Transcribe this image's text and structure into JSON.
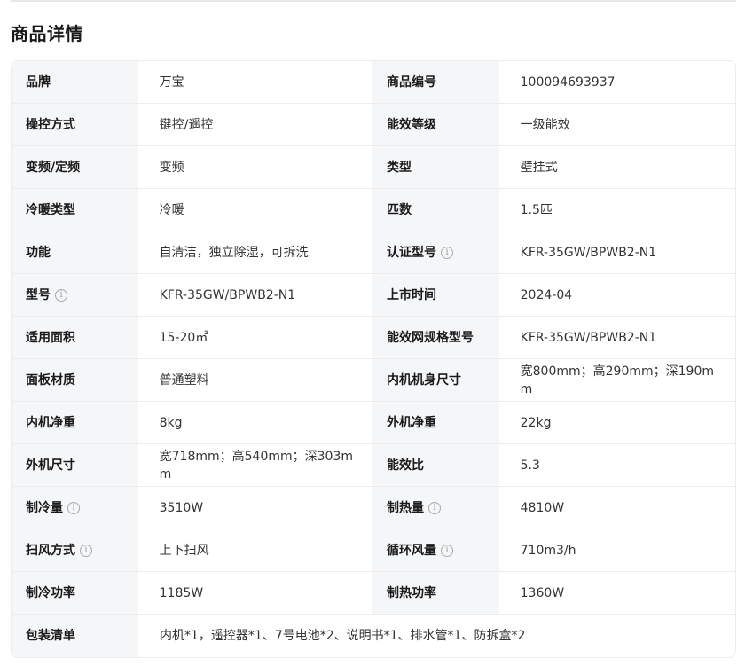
{
  "section_title": "商品详情",
  "rows": [
    {
      "l1": "品牌",
      "v1": "万宝",
      "l2": "商品编号",
      "v2": "100094693937"
    },
    {
      "l1": "操控方式",
      "v1": "键控/遥控",
      "l2": "能效等级",
      "v2": "一级能效"
    },
    {
      "l1": "变频/定频",
      "v1": "变频",
      "l2": "类型",
      "v2": "壁挂式"
    },
    {
      "l1": "冷暖类型",
      "v1": "冷暖",
      "l2": "匹数",
      "v2": "1.5匹"
    },
    {
      "l1": "功能",
      "v1": "自清洁，独立除湿，可拆洗",
      "l2": "认证型号",
      "v2": "KFR-35GW/BPWB2-N1"
    },
    {
      "l1": "型号",
      "v1": "KFR-35GW/BPWB2-N1",
      "l2": "上市时间",
      "v2": "2024-04"
    },
    {
      "l1": "适用面积",
      "v1": "15-20㎡",
      "l2": "能效网规格型号",
      "v2": "KFR-35GW/BPWB2-N1"
    },
    {
      "l1": "面板材质",
      "v1": "普通塑料",
      "l2": "内机机身尺寸",
      "v2": "宽800mm；高290mm；深190mm"
    },
    {
      "l1": "内机净重",
      "v1": "8kg",
      "l2": "外机净重",
      "v2": "22kg"
    },
    {
      "l1": "外机尺寸",
      "v1": "宽718mm；高540mm；深303mm",
      "l2": "能效比",
      "v2": "5.3"
    },
    {
      "l1": "制冷量",
      "v1": "3510W",
      "l2": "制热量",
      "v2": "4810W"
    },
    {
      "l1": "扫风方式",
      "v1": "上下扫风",
      "l2": "循环风量",
      "v2": "710m3/h"
    },
    {
      "l1": "制冷功率",
      "v1": "1185W",
      "l2": "制热功率",
      "v2": "1360W"
    }
  ],
  "package": {
    "label": "包装清单",
    "value": "内机*1，遥控器*1、7号电池*2、说明书*1、排水管*1、防拆盒*2"
  },
  "info_icon_glyph": "i"
}
